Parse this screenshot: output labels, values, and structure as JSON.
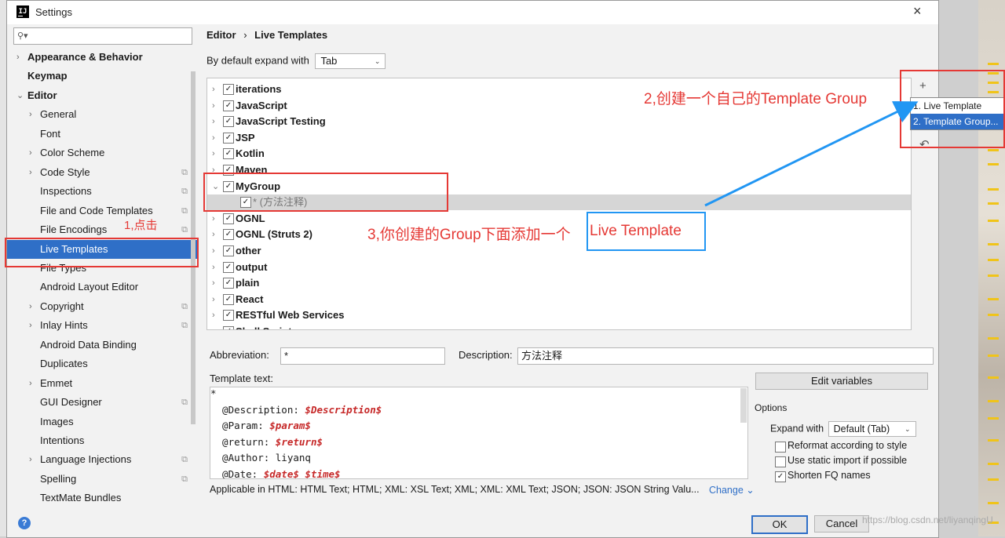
{
  "window": {
    "title": "Settings",
    "close_icon": "×",
    "app_icon_text": "IJ"
  },
  "sidebar": {
    "search_placeholder": "",
    "items": [
      {
        "label": "Appearance & Behavior",
        "bold": true,
        "arrow": "›"
      },
      {
        "label": "Keymap",
        "bold": true,
        "arrow": ""
      },
      {
        "label": "Editor",
        "bold": true,
        "arrow": "⌄"
      },
      {
        "label": "General",
        "arrow": "›"
      },
      {
        "label": "Font",
        "arrow": ""
      },
      {
        "label": "Color Scheme",
        "arrow": "›"
      },
      {
        "label": "Code Style",
        "arrow": "›",
        "icon": true
      },
      {
        "label": "Inspections",
        "arrow": "",
        "icon": true
      },
      {
        "label": "File and Code Templates",
        "arrow": "",
        "icon": true
      },
      {
        "label": "File Encodings",
        "arrow": "",
        "icon": true
      },
      {
        "label": "Live Templates",
        "arrow": "",
        "selected": true
      },
      {
        "label": "File Types",
        "arrow": ""
      },
      {
        "label": "Android Layout Editor",
        "arrow": ""
      },
      {
        "label": "Copyright",
        "arrow": "›",
        "icon": true
      },
      {
        "label": "Inlay Hints",
        "arrow": "›",
        "icon": true
      },
      {
        "label": "Android Data Binding",
        "arrow": ""
      },
      {
        "label": "Duplicates",
        "arrow": ""
      },
      {
        "label": "Emmet",
        "arrow": "›"
      },
      {
        "label": "GUI Designer",
        "arrow": "",
        "icon": true
      },
      {
        "label": "Images",
        "arrow": ""
      },
      {
        "label": "Intentions",
        "arrow": ""
      },
      {
        "label": "Language Injections",
        "arrow": "›",
        "icon": true
      },
      {
        "label": "Spelling",
        "arrow": "",
        "icon": true
      },
      {
        "label": "TextMate Bundles",
        "arrow": ""
      }
    ]
  },
  "breadcrumb": {
    "part1": "Editor",
    "sep": "›",
    "part2": "Live Templates"
  },
  "expand": {
    "label": "By default expand with",
    "value": "Tab"
  },
  "template_groups": [
    {
      "name": "iterations",
      "arrow": "›"
    },
    {
      "name": "JavaScript",
      "arrow": "›"
    },
    {
      "name": "JavaScript Testing",
      "arrow": "›"
    },
    {
      "name": "JSP",
      "arrow": "›"
    },
    {
      "name": "Kotlin",
      "arrow": "›"
    },
    {
      "name": "Maven",
      "arrow": "›"
    },
    {
      "name": "MyGroup",
      "arrow": "⌄"
    },
    {
      "name": "* (方法注释)",
      "child": true
    },
    {
      "name": "OGNL",
      "arrow": "›"
    },
    {
      "name": "OGNL (Struts 2)",
      "arrow": "›"
    },
    {
      "name": "other",
      "arrow": "›"
    },
    {
      "name": "output",
      "arrow": "›"
    },
    {
      "name": "plain",
      "arrow": "›"
    },
    {
      "name": "React",
      "arrow": "›"
    },
    {
      "name": "RESTful Web Services",
      "arrow": "›"
    },
    {
      "name": "Shell Script",
      "arrow": "›"
    }
  ],
  "toolbar": {
    "add": "+",
    "copy": "⧉",
    "remove": "▬",
    "undo": "↶"
  },
  "popup_menu": [
    "1. Live Template",
    "2. Template Group..."
  ],
  "abbreviation": {
    "label": "Abbreviation:",
    "value": "*"
  },
  "description": {
    "label": "Description:",
    "value": "方法注释"
  },
  "template_text": {
    "label": "Template text:",
    "lines": [
      [
        {
          "t": "*"
        }
      ],
      [
        {
          "t": "  @Description: "
        },
        {
          "t": "$Description$",
          "v": true
        }
      ],
      [
        {
          "t": "  @Param: "
        },
        {
          "t": "$param$",
          "v": true
        }
      ],
      [
        {
          "t": "  @return: "
        },
        {
          "t": "$return$",
          "v": true
        }
      ],
      [
        {
          "t": "  @Author: liyanq"
        }
      ],
      [
        {
          "t": "  @Date: "
        },
        {
          "t": "$date$ $time$",
          "v": true
        }
      ]
    ]
  },
  "edit_variables": "Edit variables",
  "options": {
    "title": "Options",
    "expand_label": "Expand with",
    "expand_value": "Default (Tab)",
    "checks": [
      {
        "label": "Reformat according to style",
        "checked": false
      },
      {
        "label": "Use static import if possible",
        "checked": false
      },
      {
        "label": "Shorten FQ names",
        "checked": true
      }
    ]
  },
  "applicable": {
    "text": "Applicable in HTML: HTML Text; HTML; XML: XSL Text; XML; XML: XML Text; JSON; JSON: JSON String Valu...",
    "change": "Change ⌄"
  },
  "buttons": {
    "ok": "OK",
    "cancel": "Cancel",
    "help": "?"
  },
  "annotations": {
    "step1": "1,点击",
    "step2": "2,创建一个自己的Template Group",
    "step3_prefix": "3,你创建的Group下面添加一个",
    "step3_highlight": "Live Template"
  },
  "watermark": "https://blog.csdn.net/liyanqingU"
}
